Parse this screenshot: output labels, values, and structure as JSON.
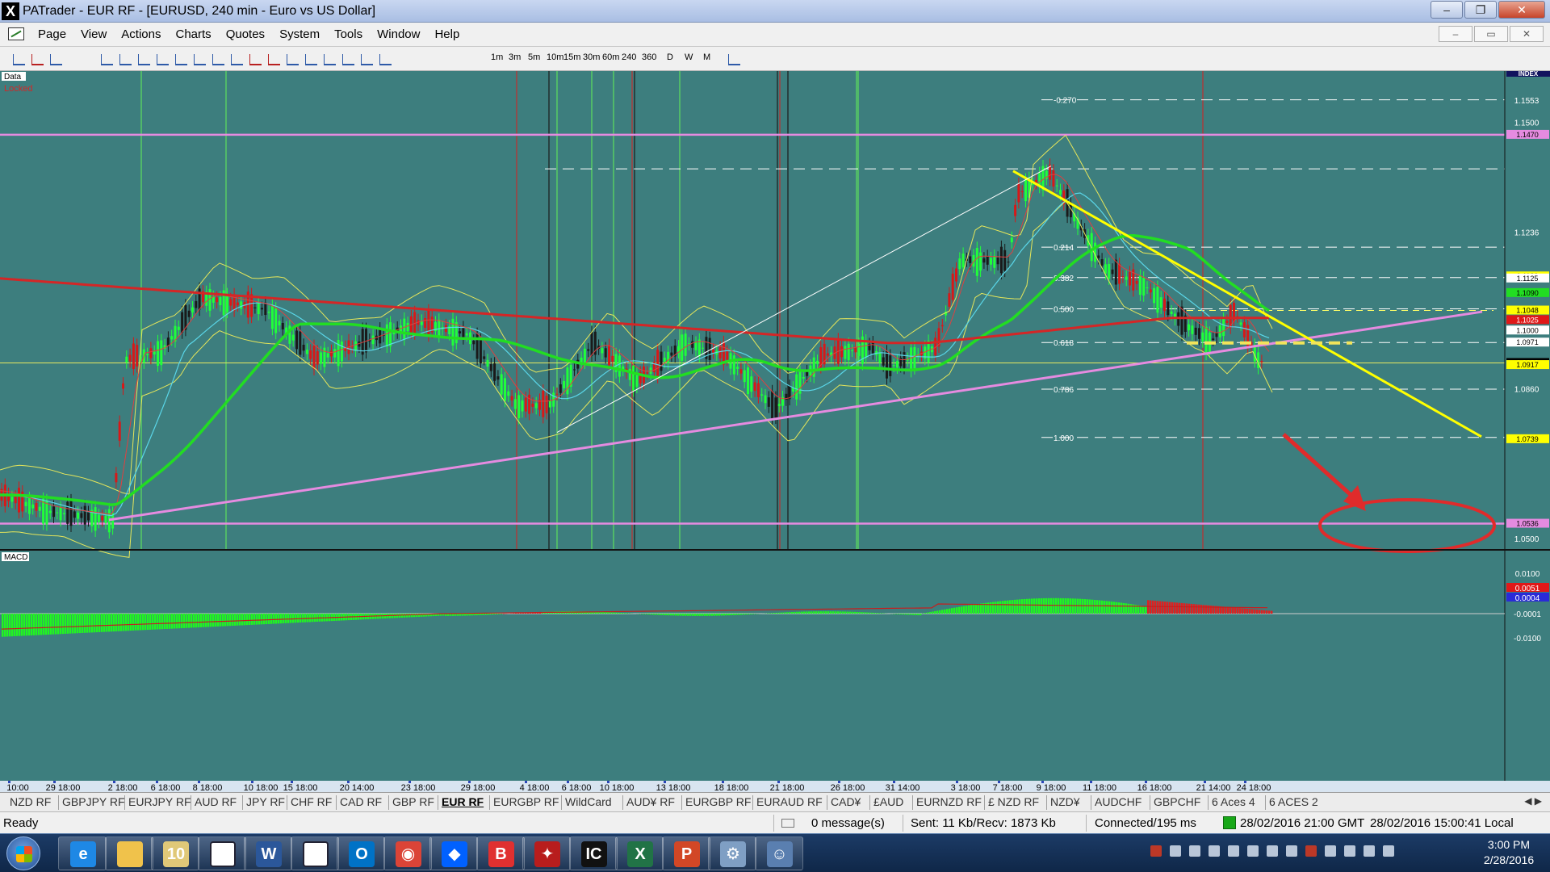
{
  "window": {
    "title": "PATrader - EUR RF - [EURUSD, 240 min - Euro vs US Dollar]",
    "app_icon": "X",
    "minimize": "–",
    "maximize": "❐",
    "close": "✕"
  },
  "menu": {
    "items": [
      "Page",
      "View",
      "Actions",
      "Charts",
      "Quotes",
      "System",
      "Tools",
      "Window",
      "Help"
    ],
    "mdi": [
      "–",
      "▭",
      "✕"
    ]
  },
  "toolbar": {
    "timeframes": [
      "1m",
      "3m",
      "5m",
      "10m",
      "15m",
      "30m",
      "60m",
      "240",
      "360",
      "D",
      "W",
      "M"
    ]
  },
  "chart": {
    "panel_label": "Data",
    "locked_label": "Locked",
    "index_label": "INDEX",
    "macd_label": "MACD",
    "price_axis": [
      {
        "v": 1.1553,
        "t": "1.1553"
      },
      {
        "v": 1.15,
        "t": "1.1500"
      },
      {
        "v": 1.1236,
        "t": "1.1236"
      },
      {
        "v": 1.086,
        "t": "1.0860"
      },
      {
        "v": 1.05,
        "t": "1.0500"
      }
    ],
    "price_badges": [
      {
        "v": 1.147,
        "t": "1.1470",
        "color": "#e58be0"
      },
      {
        "v": 1.113,
        "t": "1.1130",
        "color": "#ffff00"
      },
      {
        "v": 1.1125,
        "t": "1.1125",
        "color": "#ffffff"
      },
      {
        "v": 1.109,
        "t": "1.1090",
        "color": "#22dd22"
      },
      {
        "v": 1.1048,
        "t": "1.1048",
        "color": "#ffff00"
      },
      {
        "v": 1.1025,
        "t": "1.1025",
        "color": "#e01818"
      },
      {
        "v": 1.1,
        "t": "1.1000",
        "color": "#ffffff"
      },
      {
        "v": 1.0971,
        "t": "1.0971",
        "color": "#ffffff"
      },
      {
        "v": 1.0922,
        "t": "1.0922",
        "color": "#000000"
      },
      {
        "v": 1.0917,
        "t": "1.0917",
        "color": "#ffff00"
      },
      {
        "v": 1.0739,
        "t": "1.0739",
        "color": "#ffff00"
      },
      {
        "v": 1.0536,
        "t": "1.0536",
        "color": "#e58be0"
      }
    ],
    "fib_levels": [
      {
        "ratio": "-0.270",
        "v": 1.1554
      },
      {
        "ratio": "0.214",
        "v": 1.12
      },
      {
        "ratio": "0.382",
        "v": 1.1127
      },
      {
        "ratio": "0.500",
        "v": 1.1052
      },
      {
        "ratio": "0.618",
        "v": 1.0971
      },
      {
        "ratio": "0.786",
        "v": 1.0859
      },
      {
        "ratio": "1.000",
        "v": 1.0743
      }
    ],
    "macd_axis": [
      "0.0100",
      "0.0051",
      "0.0004",
      "-0.0001",
      "-0.0100"
    ],
    "time_axis": [
      "10:00",
      "29 18:00",
      "2 18:00",
      "6 18:00",
      "8 18:00",
      "10 18:00",
      "15 18:00",
      "20 14:00",
      "23 18:00",
      "29 18:00",
      "4 18:00",
      "6 18:00",
      "10 18:00",
      "13 18:00",
      "18 18:00",
      "21 18:00",
      "26 18:00",
      "31 14:00",
      "3 18:00",
      "7 18:00",
      "9 18:00",
      "11 18:00",
      "16 18:00",
      "21 14:00",
      "24 18:00"
    ],
    "colors": {
      "background": "#3d7e7e",
      "ema_red": "#d42626",
      "ema_green": "#22dd22",
      "trend_yellow": "#ffff00",
      "trend_pink": "#e58be0",
      "annotation_red": "#e02b2b"
    }
  },
  "symbol_tabs": [
    "NZD RF",
    "GBPJPY RF",
    "EURJPY RF",
    "AUD RF",
    "JPY RF",
    "CHF RF",
    "CAD RF",
    "GBP RF",
    "EUR RF",
    "EURGBP RF",
    "WildCard",
    "AUD¥ RF",
    "EURGBP RF",
    "EURAUD RF",
    "CAD¥",
    "£AUD",
    "EURNZD RF",
    "£ NZD RF",
    "NZD¥",
    "AUDCHF",
    "GBPCHF",
    "6 Aces 4",
    "6 ACES 2"
  ],
  "active_tab": "EUR RF",
  "tab_arrows": "◀ ▶",
  "status": {
    "ready": "Ready",
    "messages": "0 message(s)",
    "traffic": "Sent: 11 Kb/Recv: 1873 Kb",
    "connection": "Connected/195 ms",
    "server_time": "28/02/2016 21:00 GMT",
    "local_time": "28/02/2016 15:00:41 Local"
  },
  "taskbar": {
    "apps": [
      {
        "name": "internet-explorer-icon",
        "glyph": "e",
        "color": "#1e88e5"
      },
      {
        "name": "file-explorer-icon",
        "glyph": "",
        "color": "#f0c24b"
      },
      {
        "name": "calendar-icon",
        "glyph": "10",
        "color": "#e0c878"
      },
      {
        "name": "blank-window-icon",
        "glyph": "",
        "color": "#ffffff"
      },
      {
        "name": "word-icon",
        "glyph": "W",
        "color": "#2b579a"
      },
      {
        "name": "trading-chart-icon",
        "glyph": "",
        "color": "#ffffff"
      },
      {
        "name": "outlook-icon",
        "glyph": "O",
        "color": "#0072c6"
      },
      {
        "name": "chrome-icon",
        "glyph": "◉",
        "color": "#db4437"
      },
      {
        "name": "dropbox-icon",
        "glyph": "◆",
        "color": "#0061ff"
      },
      {
        "name": "brave-b-icon",
        "glyph": "B",
        "color": "#e03030"
      },
      {
        "name": "eagle-app-icon",
        "glyph": "✦",
        "color": "#b81d1d"
      },
      {
        "name": "ic-markets-icon",
        "glyph": "IC",
        "color": "#111111"
      },
      {
        "name": "excel-icon",
        "glyph": "X",
        "color": "#217346"
      },
      {
        "name": "powerpoint-icon",
        "glyph": "P",
        "color": "#d24726"
      },
      {
        "name": "tools-app-icon",
        "glyph": "⚙",
        "color": "#7f9fc4"
      },
      {
        "name": "users-app-icon",
        "glyph": "☺",
        "color": "#5a7fb0"
      }
    ],
    "time": "3:00 PM",
    "date": "2/28/2016"
  }
}
